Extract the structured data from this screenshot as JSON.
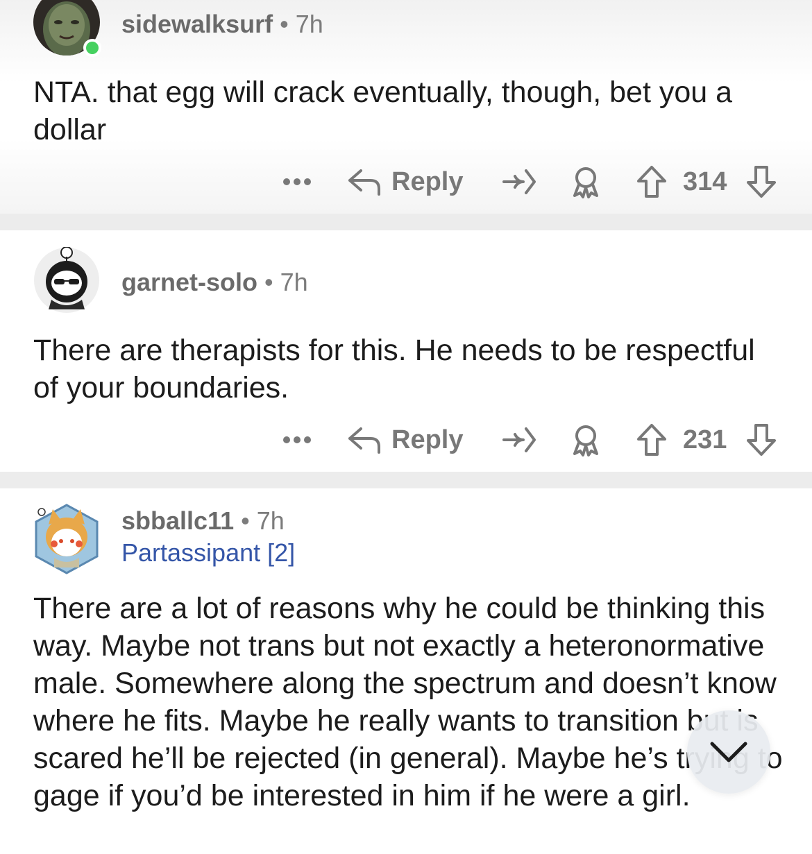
{
  "comments": [
    {
      "username": "sidewalksurf",
      "time": "7h",
      "avatar_icon": "goblin-avatar-icon",
      "online": true,
      "text": "NTA. that egg will crack eventually, though, bet you a dollar",
      "reply_label": "Reply",
      "score": "314"
    },
    {
      "username": "garnet-solo",
      "time": "7h",
      "avatar_icon": "hooded-sunglasses-avatar-icon",
      "text": "There are therapists for this. He needs to be respectful of your boundaries.",
      "reply_label": "Reply",
      "score": "231"
    },
    {
      "username": "sbballc11",
      "time": "7h",
      "flair": "Partassipant [2]",
      "avatar_icon": "shiba-hood-avatar-icon",
      "text": "There are a lot of reasons why he could be thinking this way. Maybe not trans but not exactly a heteronormative male. Somewhere along the spectrum and doesn’t know where he fits. Maybe he really wants to transition but is scared he’ll be rejected (in general). Maybe he’s trying to gage if you’d be interested in him if he were a girl."
    }
  ],
  "separator": "•",
  "colors": {
    "meta": "#7c7c7c",
    "flair": "#3556a8",
    "online": "#46d160",
    "divider": "#ececec"
  }
}
